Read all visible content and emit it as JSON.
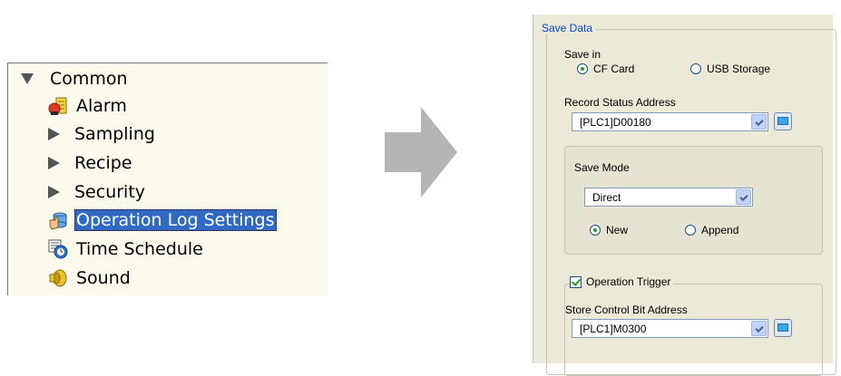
{
  "tree": {
    "items": [
      {
        "label": "Common",
        "kind": "expanded",
        "icon": "expanded-arrow-icon"
      },
      {
        "label": "Alarm",
        "kind": "leaf",
        "icon": "alarm-icon"
      },
      {
        "label": "Sampling",
        "kind": "collapsed",
        "icon": "collapsed-arrow-icon"
      },
      {
        "label": "Recipe",
        "kind": "collapsed",
        "icon": "collapsed-arrow-icon"
      },
      {
        "label": "Security",
        "kind": "collapsed",
        "icon": "collapsed-arrow-icon"
      },
      {
        "label": "Operation Log Settings",
        "kind": "leaf-selected",
        "icon": "operation-log-icon"
      },
      {
        "label": "Time Schedule",
        "kind": "leaf",
        "icon": "time-schedule-icon"
      },
      {
        "label": "Sound",
        "kind": "leaf",
        "icon": "sound-icon"
      }
    ],
    "selection_color": "#316ac5",
    "background_color": "#fcfaec"
  },
  "arrow": {
    "icon": "right-arrow-icon",
    "color": "#b5b5b5"
  },
  "dialog": {
    "group_title": "Save Data",
    "save_in_label": "Save in",
    "save_in_options": [
      "CF Card",
      "USB Storage"
    ],
    "save_in_selected": "CF Card",
    "record_status_label": "Record Status Address",
    "record_status_value": "[PLC1]D00180",
    "save_mode_label": "Save Mode",
    "save_mode_value": "Direct",
    "save_mode_options": [
      "New",
      "Append"
    ],
    "save_mode_selected": "New",
    "operation_trigger_label": "Operation Trigger",
    "operation_trigger_checked": true,
    "store_control_label": "Store Control Bit Address",
    "store_control_value": "[PLC1]M0300"
  }
}
